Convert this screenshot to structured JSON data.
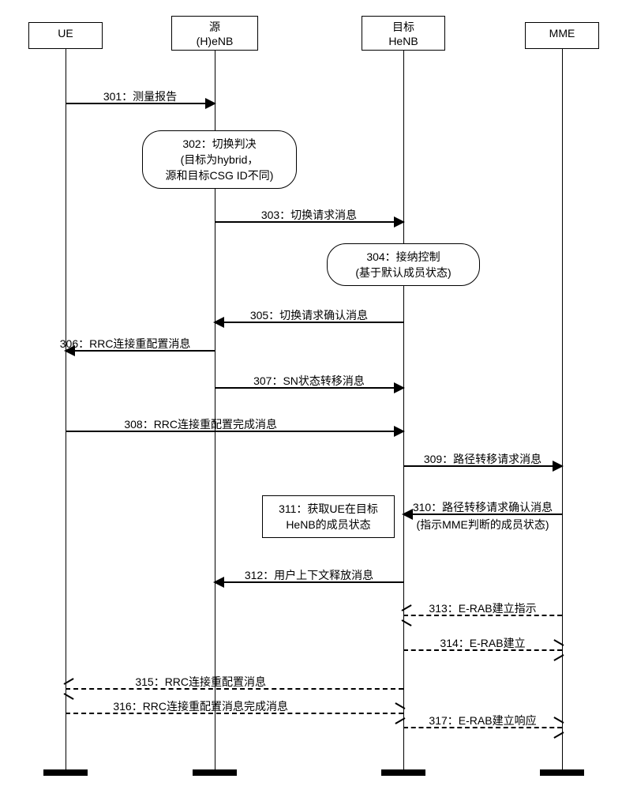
{
  "actors": {
    "ue": "UE",
    "source_line1": "源",
    "source_line2": "(H)eNB",
    "target_line1": "目标",
    "target_line2": "HeNB",
    "mme": "MME"
  },
  "steps": {
    "s301": "301：测量报告",
    "s302_l1": "302：切换判决",
    "s302_l2": "(目标为hybrid，",
    "s302_l3": "源和目标CSG ID不同)",
    "s303": "303：切换请求消息",
    "s304_l1": "304：接纳控制",
    "s304_l2": "(基于默认成员状态)",
    "s305": "305：切换请求确认消息",
    "s306": "306：RRC连接重配置消息",
    "s307": "307：SN状态转移消息",
    "s308": "308：RRC连接重配置完成消息",
    "s309": "309：路径转移请求消息",
    "s310_l1": "310：路径转移请求确认消息",
    "s310_l2": "(指示MME判断的成员状态)",
    "s311_l1": "311：获取UE在目标",
    "s311_l2": "HeNB的成员状态",
    "s312": "312：用户上下文释放消息",
    "s313": "313：E-RAB建立指示",
    "s314": "314：E-RAB建立",
    "s315": "315：RRC连接重配置消息",
    "s316": "316：RRC连接重配置消息完成消息",
    "s317": "317：E-RAB建立响应"
  },
  "chart_data": {
    "type": "sequence-diagram",
    "participants": [
      "UE",
      "源 (H)eNB",
      "目标 HeNB",
      "MME"
    ],
    "messages": [
      {
        "step": 301,
        "from": "UE",
        "to": "源 (H)eNB",
        "label": "测量报告",
        "style": "solid"
      },
      {
        "step": 302,
        "at": "源 (H)eNB",
        "note": "切换判决 (目标为hybrid，源和目标CSG ID不同)",
        "kind": "self-note"
      },
      {
        "step": 303,
        "from": "源 (H)eNB",
        "to": "目标 HeNB",
        "label": "切换请求消息",
        "style": "solid"
      },
      {
        "step": 304,
        "at": "目标 HeNB",
        "note": "接纳控制 (基于默认成员状态)",
        "kind": "self-note"
      },
      {
        "step": 305,
        "from": "目标 HeNB",
        "to": "源 (H)eNB",
        "label": "切换请求确认消息",
        "style": "solid"
      },
      {
        "step": 306,
        "from": "源 (H)eNB",
        "to": "UE",
        "label": "RRC连接重配置消息",
        "style": "solid"
      },
      {
        "step": 307,
        "from": "源 (H)eNB",
        "to": "目标 HeNB",
        "label": "SN状态转移消息",
        "style": "solid"
      },
      {
        "step": 308,
        "from": "UE",
        "to": "目标 HeNB",
        "label": "RRC连接重配置完成消息",
        "style": "solid"
      },
      {
        "step": 309,
        "from": "目标 HeNB",
        "to": "MME",
        "label": "路径转移请求消息",
        "style": "solid"
      },
      {
        "step": 310,
        "from": "MME",
        "to": "目标 HeNB",
        "label": "路径转移请求确认消息 (指示MME判断的成员状态)",
        "style": "solid"
      },
      {
        "step": 311,
        "at": "目标 HeNB",
        "note": "获取UE在目标HeNB的成员状态",
        "kind": "box-note"
      },
      {
        "step": 312,
        "from": "目标 HeNB",
        "to": "源 (H)eNB",
        "label": "用户上下文释放消息",
        "style": "solid"
      },
      {
        "step": 313,
        "from": "MME",
        "to": "目标 HeNB",
        "label": "E-RAB建立指示",
        "style": "dashed"
      },
      {
        "step": 314,
        "from": "目标 HeNB",
        "to": "MME",
        "label": "E-RAB建立",
        "style": "dashed"
      },
      {
        "step": 315,
        "from": "目标 HeNB",
        "to": "UE",
        "label": "RRC连接重配置消息",
        "style": "dashed"
      },
      {
        "step": 316,
        "from": "UE",
        "to": "目标 HeNB",
        "label": "RRC连接重配置消息完成消息",
        "style": "dashed"
      },
      {
        "step": 317,
        "from": "目标 HeNB",
        "to": "MME",
        "label": "E-RAB建立响应",
        "style": "dashed"
      }
    ]
  }
}
